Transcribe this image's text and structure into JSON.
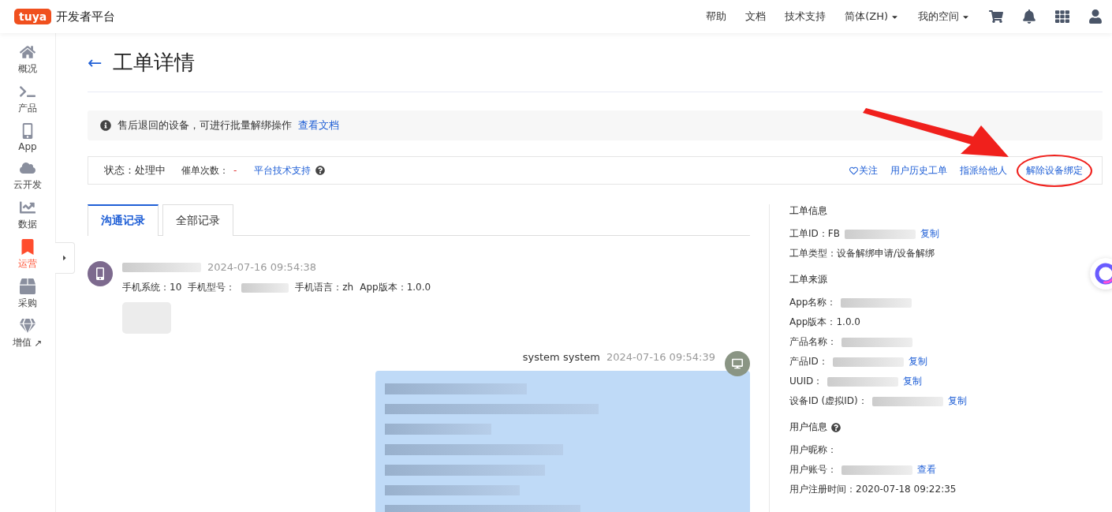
{
  "header": {
    "logo": "tuya",
    "title": "开发者平台",
    "nav": [
      {
        "label": "帮助",
        "kind": "link"
      },
      {
        "label": "文档",
        "kind": "link"
      },
      {
        "label": "技术支持",
        "kind": "link"
      },
      {
        "label": "简体(ZH)",
        "kind": "menu"
      },
      {
        "label": "我的空间",
        "kind": "menu"
      }
    ]
  },
  "sidebar": {
    "items": [
      {
        "label": "概况",
        "selected": false
      },
      {
        "label": "产品",
        "selected": false
      },
      {
        "label": "App",
        "selected": false
      },
      {
        "label": "云开发",
        "selected": false
      },
      {
        "label": "数据",
        "selected": false
      },
      {
        "label": "运营",
        "selected": true
      },
      {
        "label": "采购",
        "selected": false
      },
      {
        "label": "增值",
        "selected": false,
        "mark": "↗"
      }
    ]
  },
  "page": {
    "back": "←",
    "title": "工单详情",
    "notice": {
      "text": "售后退回的设备，可进行批量解绑操作",
      "link": "查看文档"
    },
    "status": {
      "label": "状态：",
      "value": "处理中",
      "urge_label": "催单次数：",
      "urge_value": "-",
      "support": "平台技术支持"
    },
    "actions": [
      {
        "label": "关注",
        "kind": "follow"
      },
      {
        "label": "用户历史工单",
        "kind": "link"
      },
      {
        "label": "指派给他人",
        "kind": "link"
      },
      {
        "label": "解除设备绑定",
        "kind": "highlighted"
      }
    ],
    "tabs": [
      {
        "label": "沟通记录",
        "selected": true
      },
      {
        "label": "全部记录",
        "selected": false
      }
    ],
    "messages": [
      {
        "kind": "user",
        "time": "2024-07-16 09:54:38",
        "info": [
          {
            "label": "手机系统：",
            "value": "10",
            "kind": "text"
          },
          {
            "label": "手机型号：",
            "kind": "redacted"
          },
          {
            "label": "手机语言：",
            "value": "zh",
            "kind": "text"
          },
          {
            "label": "App版本：",
            "value": "1.0.0",
            "kind": "text"
          }
        ]
      },
      {
        "kind": "system",
        "sender": "system  system",
        "time": "2024-07-16 09:54:39"
      }
    ]
  },
  "details": {
    "sections": [
      {
        "title": "工单信息",
        "kind": "plain",
        "rows": [
          {
            "label": "工单ID：",
            "value": "FB",
            "kind": "redacted",
            "link": "复制"
          },
          {
            "label": "工单类型：",
            "value": "设备解绑申请/设备解绑",
            "kind": "text"
          }
        ]
      },
      {
        "title": "工单来源",
        "kind": "plain",
        "rows": [
          {
            "label": "App名称：",
            "kind": "redacted"
          },
          {
            "label": "App版本：",
            "value": "1.0.0",
            "kind": "text"
          },
          {
            "label": "产品名称：",
            "kind": "redacted"
          },
          {
            "label": "产品ID：",
            "kind": "redacted",
            "link": "复制"
          },
          {
            "label": "UUID：",
            "kind": "redacted",
            "link": "复制"
          },
          {
            "label": "设备ID (虚拟ID)：",
            "kind": "redacted",
            "link": "复制"
          }
        ]
      },
      {
        "title": "用户信息",
        "kind": "help",
        "rows": [
          {
            "label": "用户昵称：",
            "kind": "text"
          },
          {
            "label": "用户账号：",
            "kind": "redacted",
            "link": "查看"
          },
          {
            "label": "用户注册时间：",
            "value": "2020-07-18 09:22:35",
            "kind": "text"
          }
        ]
      }
    ]
  }
}
